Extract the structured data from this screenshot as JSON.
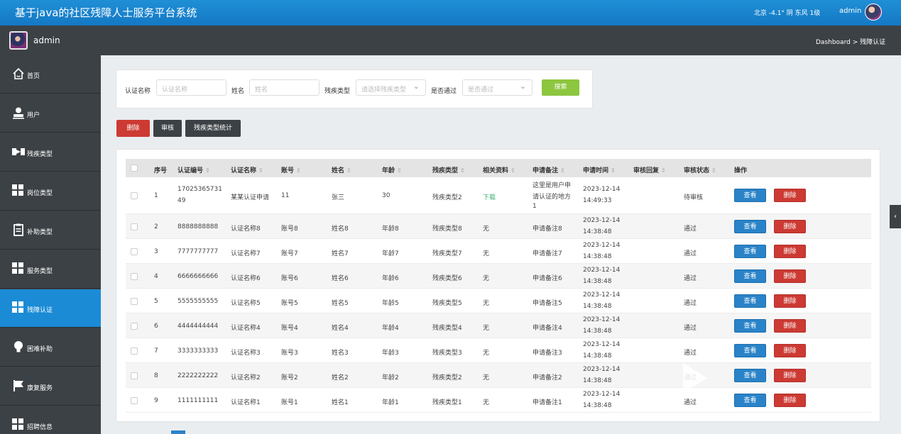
{
  "header": {
    "title": "基于java的社区残障人士服务平台系统",
    "weather": "北京 -4.1° 阴 东风 1级",
    "user": "admin"
  },
  "subheader": {
    "username": "admin",
    "breadcrumb": "Dashboard > 残障认证"
  },
  "sidebar": {
    "items": [
      {
        "label": "首页",
        "icon": "home-icon"
      },
      {
        "label": "用户",
        "icon": "user-icon"
      },
      {
        "label": "残疾类型",
        "icon": "tag-icon"
      },
      {
        "label": "岗位类型",
        "icon": "grid-icon"
      },
      {
        "label": "补助类型",
        "icon": "clipboard-icon"
      },
      {
        "label": "服务类型",
        "icon": "grid-icon"
      },
      {
        "label": "残障认证",
        "icon": "grid-icon"
      },
      {
        "label": "困难补助",
        "icon": "bulb-icon"
      },
      {
        "label": "康复服务",
        "icon": "flag-icon"
      },
      {
        "label": "招聘信息",
        "icon": "grid-icon"
      }
    ]
  },
  "search": {
    "name_label": "认证名称",
    "name_placeholder": "认证名称",
    "person_label": "姓名",
    "person_placeholder": "姓名",
    "type_label": "残疾类型",
    "type_placeholder": "请选择残疾类型",
    "pass_label": "是否通过",
    "pass_placeholder": "是否通过",
    "search_button": "搜索"
  },
  "actions": {
    "delete": "删除",
    "audit": "审核",
    "stats": "残疾类型统计"
  },
  "table": {
    "headers": [
      "序号",
      "认证编号",
      "认证名称",
      "账号",
      "姓名",
      "年龄",
      "残疾类型",
      "相关资料",
      "申请备注",
      "申请时间",
      "审核回复",
      "审核状态",
      "操作"
    ],
    "view_label": "查看",
    "delete_label": "删除",
    "rows": [
      {
        "idx": "1",
        "code1": "17025365731",
        "code2": "49",
        "name": "某某认证申请",
        "account": "11",
        "person": "张三",
        "age": "30",
        "type": "残疾类型2",
        "file": "下载",
        "note1": "这里是用户申",
        "note2": "请认证的地方",
        "note3": "1",
        "date": "2023-12-14",
        "time": "14:49:33",
        "status": "待审核"
      },
      {
        "idx": "2",
        "code1": "8888888888",
        "name": "认证名称8",
        "account": "账号8",
        "person": "姓名8",
        "age": "年龄8",
        "type": "残疾类型8",
        "file": "无",
        "note1": "申请备注8",
        "date": "2023-12-14",
        "time": "14:38:48",
        "status": "通过"
      },
      {
        "idx": "3",
        "code1": "7777777777",
        "name": "认证名称7",
        "account": "账号7",
        "person": "姓名7",
        "age": "年龄7",
        "type": "残疾类型7",
        "file": "无",
        "note1": "申请备注7",
        "date": "2023-12-14",
        "time": "14:38:48",
        "status": "通过"
      },
      {
        "idx": "4",
        "code1": "6666666666",
        "name": "认证名称6",
        "account": "账号6",
        "person": "姓名6",
        "age": "年龄6",
        "type": "残疾类型6",
        "file": "无",
        "note1": "申请备注6",
        "date": "2023-12-14",
        "time": "14:38:48",
        "status": "通过"
      },
      {
        "idx": "5",
        "code1": "5555555555",
        "name": "认证名称5",
        "account": "账号5",
        "person": "姓名5",
        "age": "年龄5",
        "type": "残疾类型5",
        "file": "无",
        "note1": "申请备注5",
        "date": "2023-12-14",
        "time": "14:38:48",
        "status": "通过"
      },
      {
        "idx": "6",
        "code1": "4444444444",
        "name": "认证名称4",
        "account": "账号4",
        "person": "姓名4",
        "age": "年龄4",
        "type": "残疾类型4",
        "file": "无",
        "note1": "申请备注4",
        "date": "2023-12-14",
        "time": "14:38:48",
        "status": "通过"
      },
      {
        "idx": "7",
        "code1": "3333333333",
        "name": "认证名称3",
        "account": "账号3",
        "person": "姓名3",
        "age": "年龄3",
        "type": "残疾类型3",
        "file": "无",
        "note1": "申请备注3",
        "date": "2023-12-14",
        "time": "14:38:48",
        "status": "通过"
      },
      {
        "idx": "8",
        "code1": "2222222222",
        "name": "认证名称2",
        "account": "账号2",
        "person": "姓名2",
        "age": "年龄2",
        "type": "残疾类型2",
        "file": "无",
        "note1": "申请备注2",
        "date": "2023-12-14",
        "time": "14:38:48",
        "status": "通过"
      },
      {
        "idx": "9",
        "code1": "1111111111",
        "name": "认证名称1",
        "account": "账号1",
        "person": "姓名1",
        "age": "年龄1",
        "type": "残疾类型1",
        "file": "无",
        "note1": "申请备注1",
        "date": "2023-12-14",
        "time": "14:38:48",
        "status": "通过"
      }
    ]
  },
  "colors": {
    "primary": "#1b8bd6",
    "danger": "#cc3a33",
    "success": "#8dc63f",
    "sidebar": "#3c4145",
    "link": "#3cb371"
  }
}
